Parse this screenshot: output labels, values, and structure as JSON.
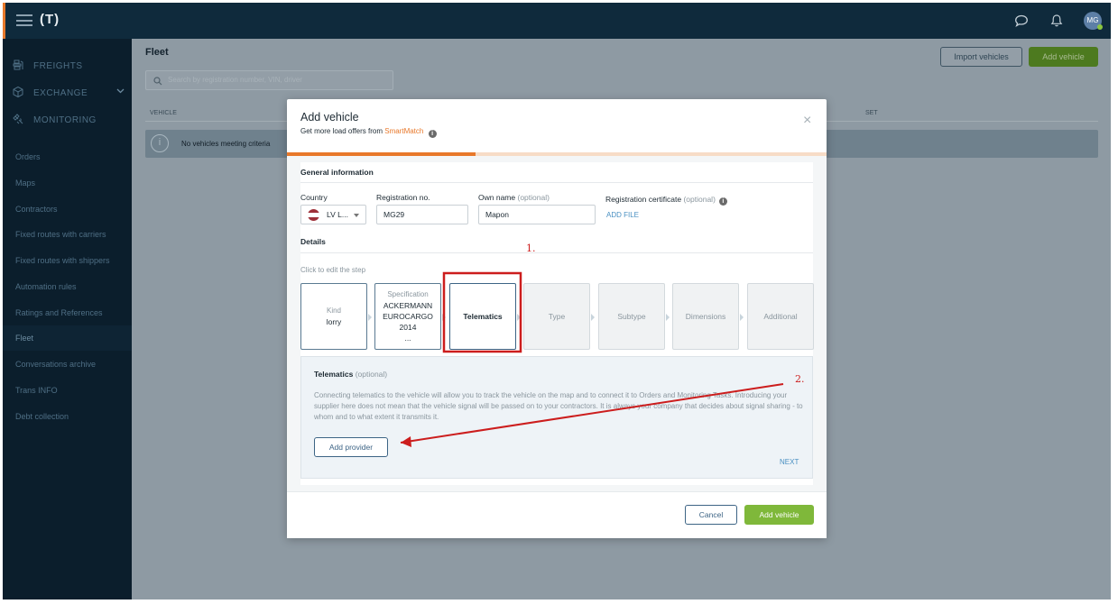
{
  "topbar": {
    "logo": "(T)",
    "avatar_initials": "MG"
  },
  "sidebar": {
    "main_items": [
      {
        "label": "FREIGHTS",
        "icon": "freights-icon"
      },
      {
        "label": "EXCHANGE",
        "icon": "exchange-cube-icon"
      },
      {
        "label": "MONITORING",
        "icon": "monitoring-satellite-icon"
      }
    ],
    "items": [
      {
        "label": "Orders"
      },
      {
        "label": "Maps"
      },
      {
        "label": "Contractors"
      },
      {
        "label": "Fixed routes with carriers"
      },
      {
        "label": "Fixed routes with shippers"
      },
      {
        "label": "Automation rules"
      },
      {
        "label": "Ratings and References"
      },
      {
        "label": "Fleet",
        "active": true
      },
      {
        "label": "Conversations archive"
      },
      {
        "label": "Trans INFO"
      },
      {
        "label": "Debt collection"
      }
    ]
  },
  "page": {
    "title": "Fleet",
    "search_placeholder": "Search by registration number, VIN, driver",
    "import_label": "Import vehicles",
    "add_label": "Add vehicle",
    "columns": {
      "vehicle": "VEHICLE",
      "set": "SET"
    },
    "empty_text": "No vehicles meeting criteria"
  },
  "modal": {
    "title": "Add vehicle",
    "subtitle_prefix": "Get more load offers from",
    "subtitle_brand": "SmartMatch",
    "close": "×",
    "general_heading": "General information",
    "country_label": "Country",
    "country_value": "LV L...",
    "registration_label": "Registration no.",
    "registration_value": "MG29",
    "own_name_label": "Own name",
    "own_name_optional": "(optional)",
    "own_name_value": "Mapon",
    "cert_label": "Registration certificate",
    "cert_optional": "(optional)",
    "add_file": "ADD FILE",
    "details_heading": "Details",
    "step_hint": "Click to edit the step",
    "steps": {
      "kind_label": "Kind",
      "kind_value": "lorry",
      "spec_label": "Specification",
      "spec_line1": "ACKERMANN",
      "spec_line2": "EUROCARGO",
      "spec_line3": "2014",
      "spec_line4": "...",
      "telematics": "Telematics",
      "type": "Type",
      "subtype": "Subtype",
      "dimensions": "Dimensions",
      "additional": "Additional"
    },
    "telematics_title": "Telematics",
    "telematics_optional": "(optional)",
    "telematics_desc": "Connecting telematics to the vehicle will allow you to track the vehicle on the map and to connect it to Orders and Monitoring Tasks. Introducing your supplier here does not mean that the vehicle signal will be passed on to your contractors. It is always your company that decides about signal sharing - to whom and to what extent it transmits it.",
    "add_provider": "Add provider",
    "next": "NEXT",
    "cancel": "Cancel",
    "add_vehicle": "Add vehicle"
  },
  "annotations": {
    "step1": "1.",
    "step2": "2."
  },
  "colors": {
    "accent_orange": "#e8782a",
    "green": "#7fb83a",
    "annotation_red": "#cc1d1d",
    "nav_dark": "#0f2a3c"
  }
}
